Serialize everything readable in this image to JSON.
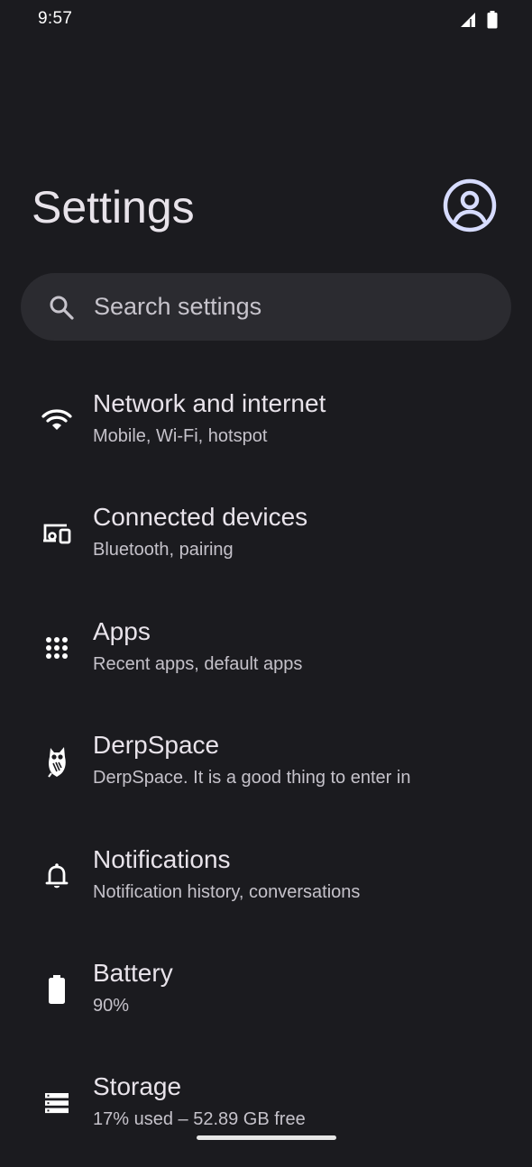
{
  "status_bar": {
    "time": "9:57",
    "icons": [
      "signal-icon",
      "battery-icon"
    ]
  },
  "header": {
    "title": "Settings",
    "avatar_icon": "account-circle-icon"
  },
  "search": {
    "placeholder": "Search settings",
    "icon": "search-icon"
  },
  "settings_items": [
    {
      "icon": "wifi-icon",
      "title": "Network and internet",
      "subtitle": "Mobile, Wi-Fi, hotspot"
    },
    {
      "icon": "devices-icon",
      "title": "Connected devices",
      "subtitle": "Bluetooth, pairing"
    },
    {
      "icon": "apps-grid-icon",
      "title": "Apps",
      "subtitle": "Recent apps, default apps"
    },
    {
      "icon": "owl-icon",
      "title": "DerpSpace",
      "subtitle": "DerpSpace. It is a good thing to enter in"
    },
    {
      "icon": "bell-icon",
      "title": "Notifications",
      "subtitle": "Notification history, conversations"
    },
    {
      "icon": "battery-icon",
      "title": "Battery",
      "subtitle": "90%"
    },
    {
      "icon": "storage-icon",
      "title": "Storage",
      "subtitle": "17% used – 52.89 GB free"
    }
  ],
  "colors": {
    "background": "#1b1b1f",
    "search_background": "#2b2b30",
    "primary_text": "#e8e3ea",
    "secondary_text": "#c5c2ca",
    "accent": "#d7dcff"
  }
}
